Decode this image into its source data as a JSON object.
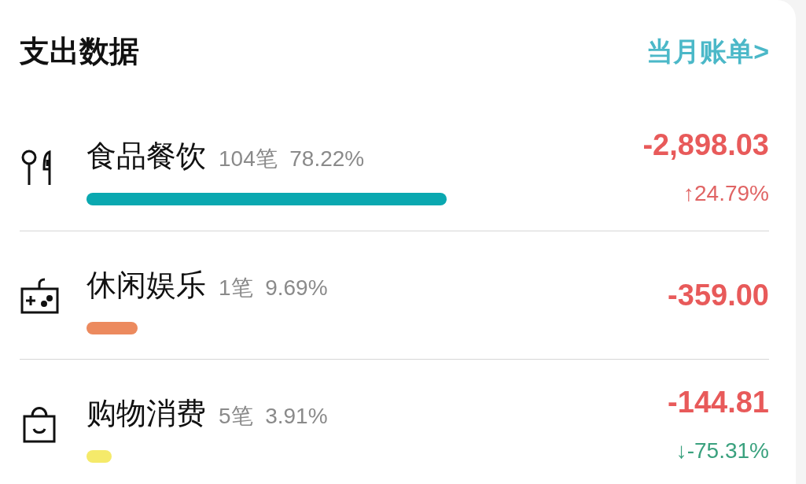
{
  "header": {
    "title": "支出数据",
    "link": "当月账单>"
  },
  "categories": [
    {
      "kind": "utensils",
      "name": "食品餐饮",
      "count": "104笔",
      "share": "78.22%",
      "color": "#0aa8b0",
      "amount": "-2,898.03",
      "change": {
        "kind": "up",
        "arrow": "↑",
        "text": "24.79%"
      }
    },
    {
      "kind": "gamepad",
      "name": "休闲娱乐",
      "count": "1笔",
      "share": "9.69%",
      "color": "#ec8a5e",
      "amount": "-359.00"
    },
    {
      "kind": "bag",
      "name": "购物消费",
      "count": "5笔",
      "share": "3.91%",
      "color": "#f5ea6a",
      "amount": "-144.81",
      "change": {
        "kind": "down",
        "arrow": "↓",
        "text": "-75.31%"
      }
    }
  ]
}
